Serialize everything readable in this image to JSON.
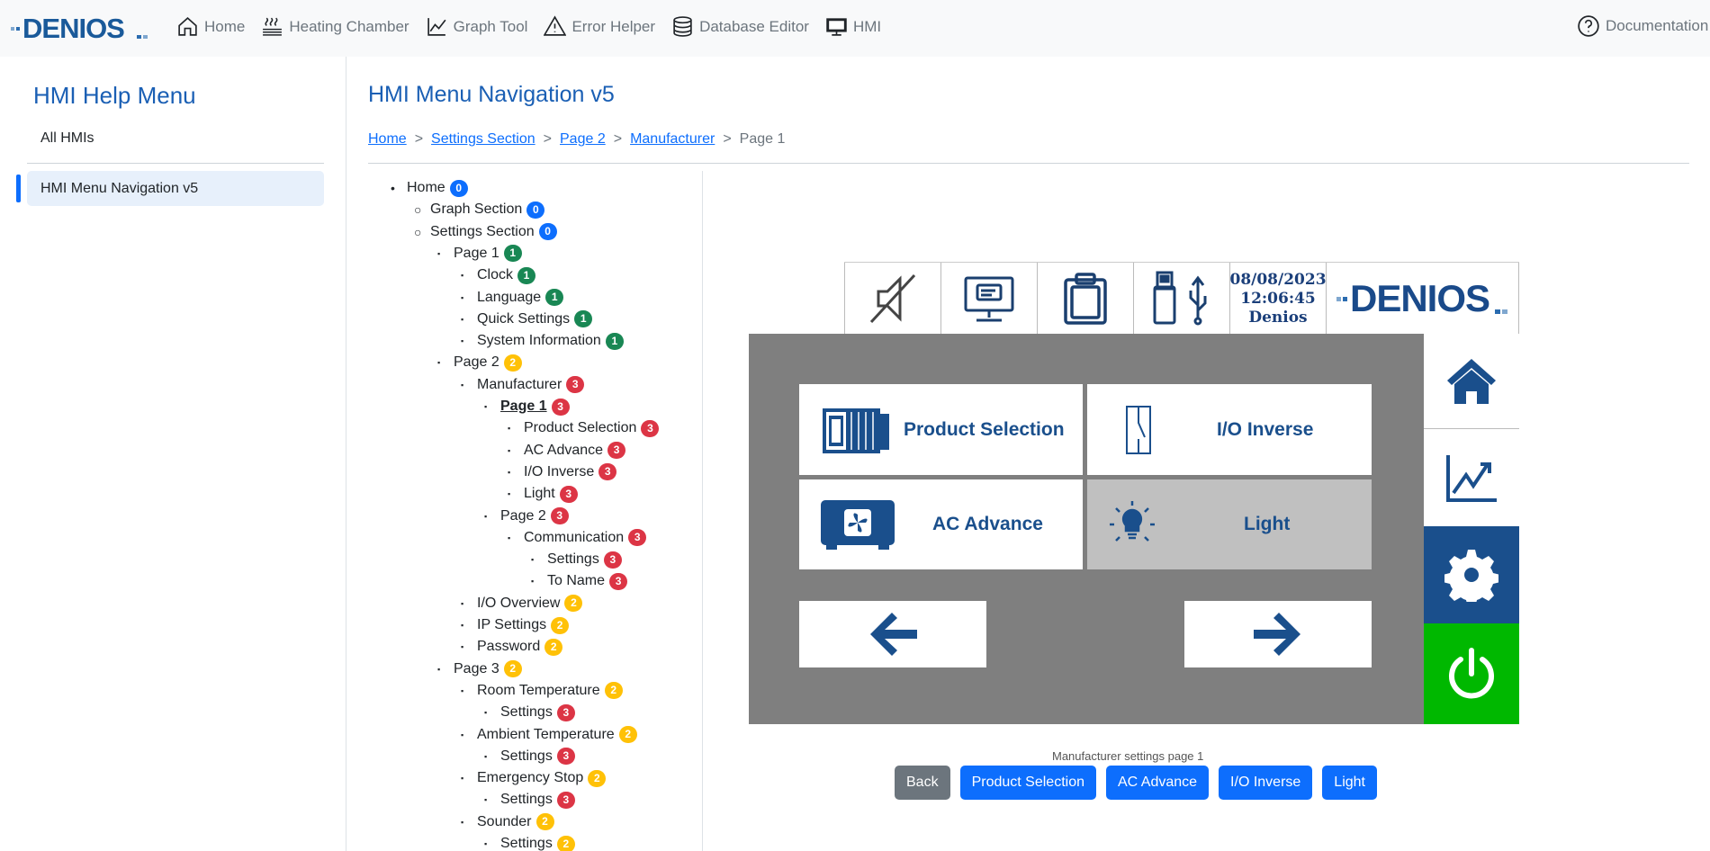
{
  "nav": {
    "logo_text": "DENIOS",
    "items": [
      {
        "label": "Home",
        "icon": "home-icon"
      },
      {
        "label": "Heating Chamber",
        "icon": "heat-icon"
      },
      {
        "label": "Graph Tool",
        "icon": "chart-line-icon"
      },
      {
        "label": "Error Helper",
        "icon": "warning-icon"
      },
      {
        "label": "Database Editor",
        "icon": "database-icon"
      },
      {
        "label": "HMI",
        "icon": "monitor-icon"
      }
    ],
    "documentation": "Documentation"
  },
  "sidebar": {
    "title": "HMI Help Menu",
    "all_label": "All HMIs",
    "active_item": "HMI Menu Navigation v5"
  },
  "main": {
    "title": "HMI Menu Navigation v5",
    "breadcrumb": [
      "Home",
      "Settings Section",
      "Page 2",
      "Manufacturer"
    ],
    "breadcrumb_current": "Page 1"
  },
  "tree": [
    {
      "label": "Home",
      "badge": "0",
      "level": 0
    },
    {
      "label": "Graph Section",
      "badge": "0",
      "level": 1
    },
    {
      "label": "Settings Section",
      "badge": "0",
      "level": 1
    },
    {
      "label": "Page 1",
      "badge": "1",
      "level": 2
    },
    {
      "label": "Clock",
      "badge": "1",
      "level": 3
    },
    {
      "label": "Language",
      "badge": "1",
      "level": 3
    },
    {
      "label": "Quick Settings",
      "badge": "1",
      "level": 3
    },
    {
      "label": "System Information",
      "badge": "1",
      "level": 3
    },
    {
      "label": "Page 2",
      "badge": "2",
      "level": 2
    },
    {
      "label": "Manufacturer",
      "badge": "3",
      "level": 3
    },
    {
      "label": "Page 1",
      "badge": "3",
      "level": 4,
      "active": true
    },
    {
      "label": "Product Selection",
      "badge": "3",
      "level": 5
    },
    {
      "label": "AC Advance",
      "badge": "3",
      "level": 5
    },
    {
      "label": "I/O Inverse",
      "badge": "3",
      "level": 5
    },
    {
      "label": "Light",
      "badge": "3",
      "level": 5
    },
    {
      "label": "Page 2",
      "badge": "3",
      "level": 4
    },
    {
      "label": "Communication",
      "badge": "3",
      "level": 5
    },
    {
      "label": "Settings",
      "badge": "3",
      "level": 6
    },
    {
      "label": "To Name",
      "badge": "3",
      "level": 6
    },
    {
      "label": "I/O Overview",
      "badge": "2",
      "level": 3
    },
    {
      "label": "IP Settings",
      "badge": "2",
      "level": 3
    },
    {
      "label": "Password",
      "badge": "2",
      "level": 3
    },
    {
      "label": "Page 3",
      "badge": "2",
      "level": 2
    },
    {
      "label": "Room Temperature",
      "badge": "2",
      "level": 3
    },
    {
      "label": "Settings",
      "badge": "3",
      "level": 4
    },
    {
      "label": "Ambient Temperature",
      "badge": "2",
      "level": 3
    },
    {
      "label": "Settings",
      "badge": "3",
      "level": 4
    },
    {
      "label": "Emergency Stop",
      "badge": "2",
      "level": 3
    },
    {
      "label": "Settings",
      "badge": "3",
      "level": 4
    },
    {
      "label": "Sounder",
      "badge": "2",
      "level": 3
    },
    {
      "label": "Settings",
      "badge": "2",
      "level": 4
    }
  ],
  "hmi": {
    "date": "08/08/2023",
    "time": "12:06:45",
    "user": "Denios",
    "logo_text": "DENIOS",
    "tiles": {
      "product_selection": "Product Selection",
      "io_inverse": "I/O Inverse",
      "ac_advance": "AC Advance",
      "light": "Light"
    },
    "caption": "Manufacturer settings page 1"
  },
  "buttons": {
    "back": "Back",
    "product_selection": "Product Selection",
    "ac_advance": "AC Advance",
    "io_inverse": "I/O Inverse",
    "light": "Light"
  },
  "colors": {
    "accent": "#0d6efd",
    "brand_blue": "#1a4f8c",
    "hmi_gray": "#7f7f7f",
    "power_green": "#00b800"
  }
}
